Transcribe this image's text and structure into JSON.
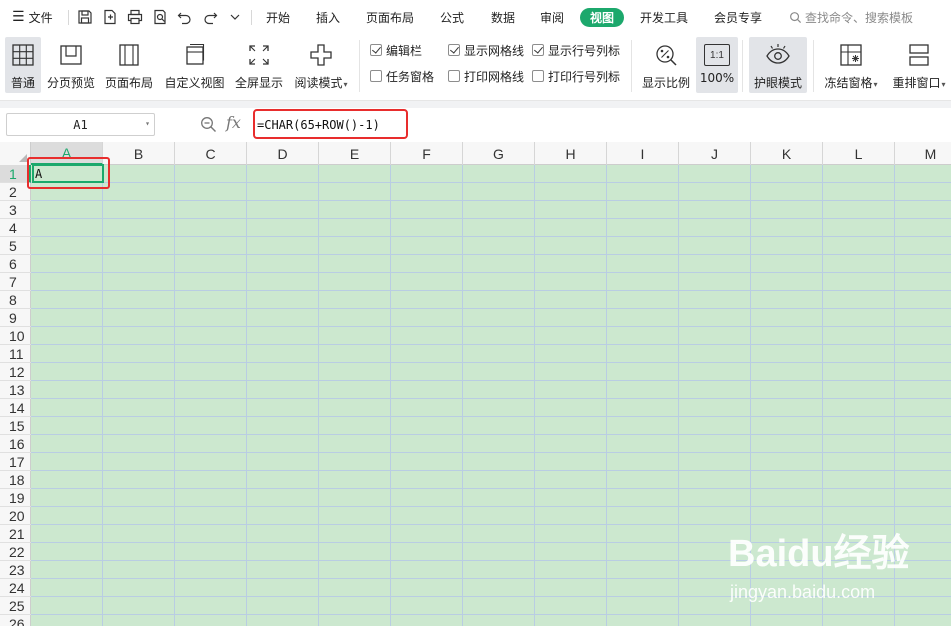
{
  "menubar": {
    "menu_icon": "hamburger-icon",
    "file_label": "文件",
    "quick_access_icons": [
      "save-icon",
      "export-pdf-icon",
      "print-icon",
      "print-preview-icon",
      "undo-icon",
      "redo-icon",
      "more-dropdown-icon"
    ],
    "tabs": [
      {
        "label": "开始",
        "active": false
      },
      {
        "label": "插入",
        "active": false
      },
      {
        "label": "页面布局",
        "active": false
      },
      {
        "label": "公式",
        "active": false
      },
      {
        "label": "数据",
        "active": false
      },
      {
        "label": "审阅",
        "active": false
      },
      {
        "label": "视图",
        "active": true
      },
      {
        "label": "开发工具",
        "active": false
      },
      {
        "label": "会员专享",
        "active": false
      }
    ],
    "search_placeholder": "查找命令、搜索模板",
    "accent_color": "#1ca86c"
  },
  "ribbon": {
    "buttons": [
      {
        "label": "普通",
        "icon": "normal-view-icon",
        "pressed": true
      },
      {
        "label": "分页预览",
        "icon": "page-break-preview-icon",
        "pressed": false
      },
      {
        "label": "页面布局",
        "icon": "page-layout-icon",
        "pressed": false
      },
      {
        "label": "自定义视图",
        "icon": "custom-view-icon",
        "pressed": false
      },
      {
        "label": "全屏显示",
        "icon": "fullscreen-icon",
        "pressed": false
      },
      {
        "label": "阅读模式",
        "icon": "reading-mode-icon",
        "pressed": false
      }
    ],
    "checkboxes": [
      {
        "label": "编辑栏",
        "checked": true
      },
      {
        "label": "任务窗格",
        "checked": false
      },
      {
        "label": "显示网格线",
        "checked": true
      },
      {
        "label": "打印网格线",
        "checked": false
      },
      {
        "label": "显示行号列标",
        "checked": true
      },
      {
        "label": "打印行号列标",
        "checked": false
      }
    ],
    "zoom_label": "显示比例",
    "zoom100_icon_text": "1:1",
    "zoom100_label": "100%",
    "eye_mode_label": "护眼模式",
    "freeze_label": "冻结窗格",
    "arrange_label": "重排窗口"
  },
  "formula_bar": {
    "cell_ref": "A1",
    "fx_label": "fx",
    "formula": "=CHAR(65+ROW()-1)"
  },
  "sheet": {
    "columns": [
      "A",
      "B",
      "C",
      "D",
      "E",
      "F",
      "G",
      "H",
      "I",
      "J",
      "K",
      "L",
      "M"
    ],
    "rows": [
      "1",
      "2",
      "3",
      "4",
      "5",
      "6",
      "7",
      "8",
      "9",
      "10",
      "11",
      "12",
      "13",
      "14",
      "15",
      "16",
      "17",
      "18",
      "19",
      "20",
      "21",
      "22",
      "23",
      "24",
      "25",
      "26"
    ],
    "selected_cell_value": "A",
    "background_color": "#cce8cf"
  },
  "watermark": {
    "brand": "Baidu经验",
    "url": "jingyan.baidu.com"
  }
}
